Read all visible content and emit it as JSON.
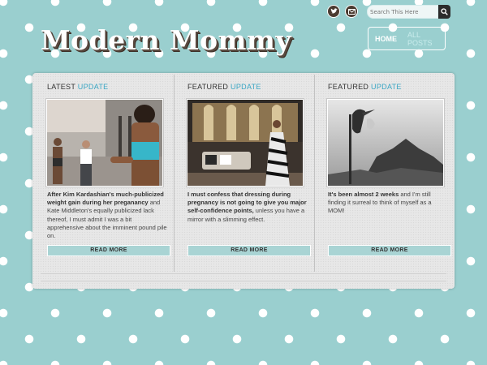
{
  "header": {
    "logo_text": "Modern Mommy",
    "search_placeholder": "Search This Here",
    "icons": [
      "twitter-icon",
      "email-icon",
      "search-icon"
    ],
    "nav": {
      "home": "HOME",
      "all_posts": "ALL POSTS"
    }
  },
  "columns": [
    {
      "label_main": "LATEST",
      "label_accent": "UPDATE",
      "bold_text": "After Kim Kardashian's much-publicized weight gain during her preganancy",
      "rest_text": " and Kate Middleton's equally publicized lack thereof, I must admit I was a bit apprehensive about the imminent pound pile on.",
      "button": "READ MORE"
    },
    {
      "label_main": "FEATURED",
      "label_accent": "UPDATE",
      "bold_text": "I must confess that dressing during pregnancy is not going to give you major self-confidence points,",
      "rest_text": " unless you have a mirror with a slimming effect.",
      "button": "READ MORE"
    },
    {
      "label_main": "FEATURED",
      "label_accent": "UPDATE",
      "bold_text": "It's been almost 2 weeks",
      "rest_text": " and I'm still finding it surreal to think of myself as a MOM!",
      "button": "READ MORE"
    }
  ],
  "colors": {
    "background": "#9acfcf",
    "accent": "#3aa6c4",
    "button": "#a9d4d4",
    "panel": "#e7e7e7"
  }
}
